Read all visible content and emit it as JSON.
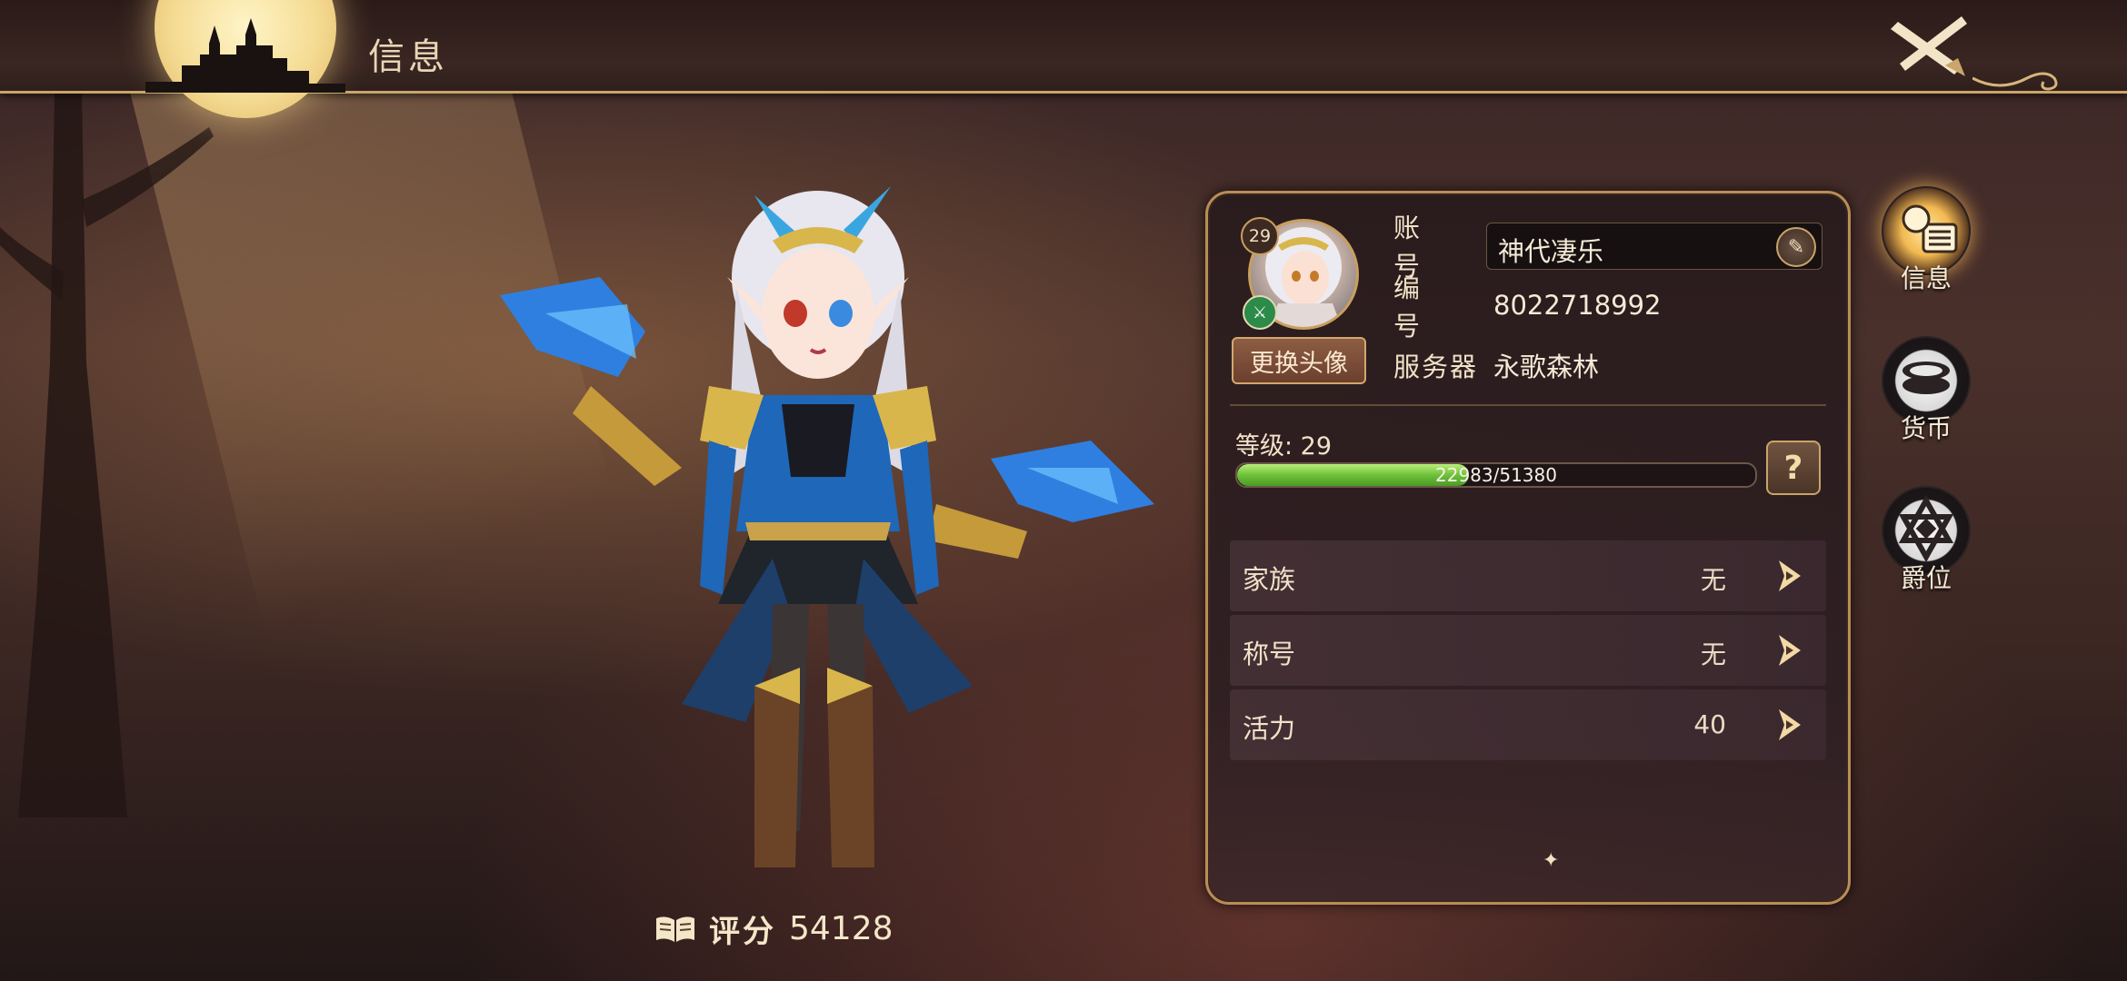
{
  "header": {
    "title": "信息"
  },
  "character": {
    "score_label": "评分",
    "score_value": "54128"
  },
  "profile": {
    "avatar_level": "29",
    "change_avatar_label": "更换头像",
    "account_label": "账 号",
    "account_value": "神代凄乐",
    "id_label": "编 号",
    "id_value": "8022718992",
    "server_label": "服务器",
    "server_value": "永歌森林",
    "level_label": "等级: 29",
    "exp_text": "22983/51380",
    "exp_current": 22983,
    "exp_max": 51380,
    "help_label": "?"
  },
  "menu": [
    {
      "label": "家族",
      "value": "无"
    },
    {
      "label": "称号",
      "value": "无"
    },
    {
      "label": "活力",
      "value": "40"
    }
  ],
  "side_tabs": [
    {
      "label": "信息",
      "icon": "info-scroll-icon",
      "active": true
    },
    {
      "label": "货币",
      "icon": "coins-icon",
      "active": false
    },
    {
      "label": "爵位",
      "icon": "star-badge-icon",
      "active": false
    }
  ],
  "colors": {
    "accent_gold": "#c9a46a",
    "exp_green": "#6fc03a",
    "panel_bg": "#2c1e22"
  }
}
